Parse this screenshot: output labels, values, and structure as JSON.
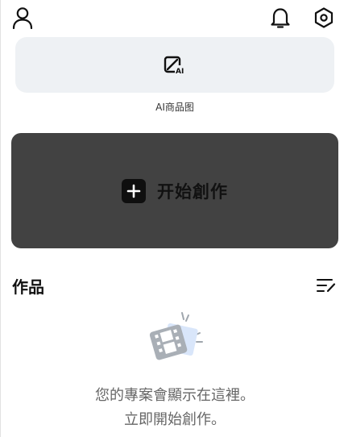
{
  "header": {
    "profile_icon": "person-icon",
    "notification_icon": "bell-icon",
    "settings_icon": "hexagon-settings-icon"
  },
  "ai_product": {
    "icon": "ai-image-edit-icon",
    "label": "AI商品图"
  },
  "start_create": {
    "icon": "plus-icon",
    "label": "开始創作"
  },
  "works": {
    "title": "作品",
    "edit_icon": "list-edit-icon"
  },
  "empty_state": {
    "illustration": "film-strip-icon",
    "line1": "您的專案會顯示在這裡。",
    "line2": "立即開始創作。"
  },
  "colors": {
    "card_bg": "#eef1f4",
    "start_bg": "#424242",
    "illustration_accent": "#d9e6fa"
  }
}
